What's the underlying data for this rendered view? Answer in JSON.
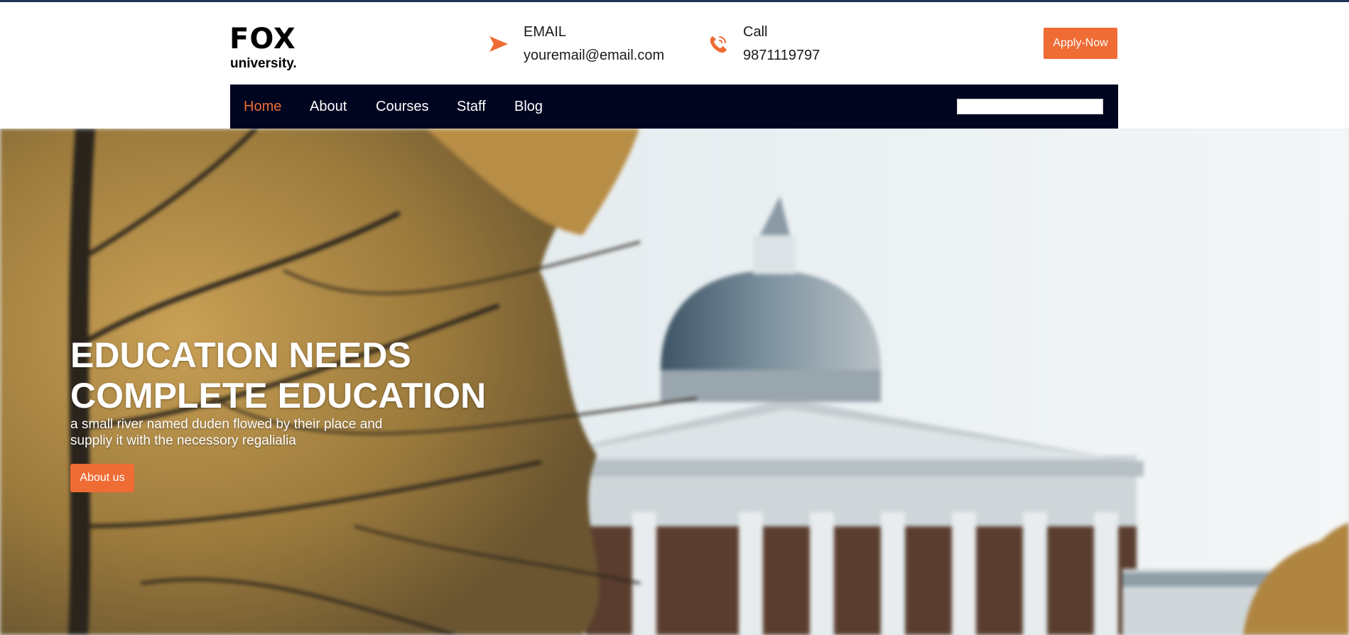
{
  "brand": {
    "title": "FOX",
    "subtitle": "university."
  },
  "contacts": [
    {
      "label": "EMAIL",
      "value": "youremail@email.com",
      "icon": "send-icon"
    },
    {
      "label": "Call",
      "value": "9871119797",
      "icon": "phone-icon"
    }
  ],
  "header": {
    "apply_label": "Apply-Now"
  },
  "nav": {
    "items": [
      {
        "label": "Home",
        "active": true
      },
      {
        "label": "About",
        "active": false
      },
      {
        "label": "Courses",
        "active": false
      },
      {
        "label": "Staff",
        "active": false
      },
      {
        "label": "Blog",
        "active": false
      }
    ],
    "search_value": ""
  },
  "hero": {
    "title_line1": "EDUCATION NEEDS",
    "title_line2": "COMPLETE EDUCATION",
    "text_line1": "a small river named duden flowed by their place and",
    "text_line2": "suppliy it with the necessory regalialia",
    "button_label": "About us"
  },
  "colors": {
    "accent": "#ef6c35",
    "navbar": "#000520",
    "top_strip": "#1d3557"
  }
}
